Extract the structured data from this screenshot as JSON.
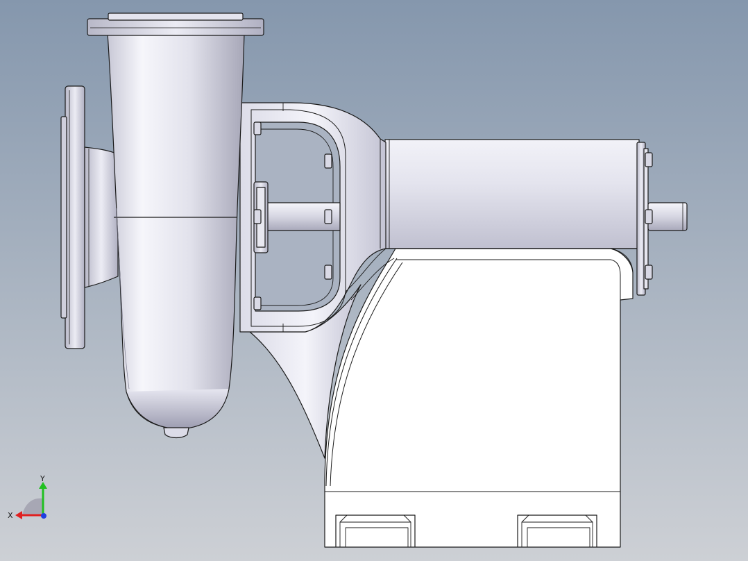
{
  "viewport": {
    "background_top": "#8a9bb0",
    "background_bottom": "#c9cdd3"
  },
  "model": {
    "part": "centrifugal-pump-assembly",
    "line_color": "#1a1a1a",
    "metal_light": "#f2f2f8",
    "metal_mid": "#d6d6e2",
    "metal_dark": "#a9a9b8"
  },
  "triad": {
    "x_label": "X",
    "y_label": "Y",
    "x_color": "#e02020",
    "y_color": "#20c020",
    "z_color": "#2040e0"
  }
}
